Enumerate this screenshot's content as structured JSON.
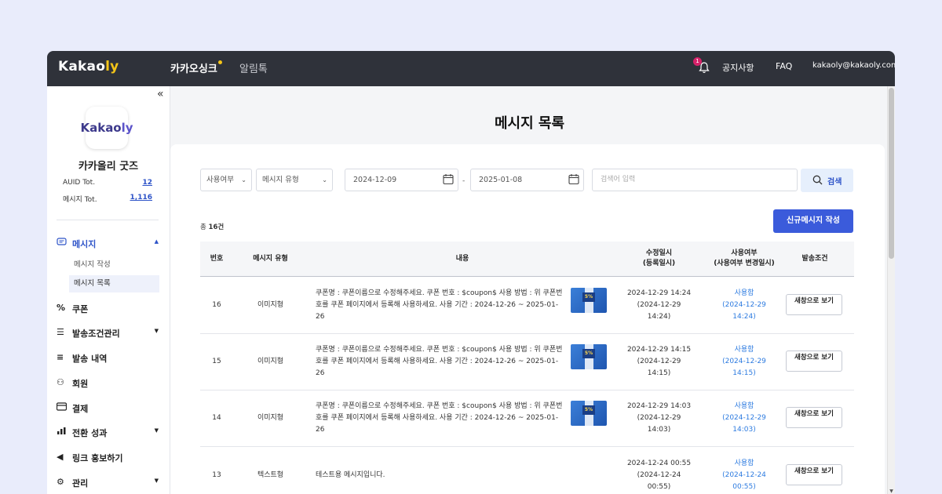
{
  "header": {
    "logo_main": "Kakao",
    "logo_accent": "ly",
    "nav": [
      {
        "label": "카카오싱크"
      },
      {
        "label": "알림톡"
      }
    ],
    "notification_count": "1",
    "links": {
      "notice": "공지사항",
      "faq": "FAQ",
      "account": "kakaoly@kakaoly.com"
    }
  },
  "sidebar": {
    "collapse_label": "«",
    "avatar_main": "Kakao",
    "avatar_accent": "ly",
    "company": "카카올리 굿즈",
    "stats": [
      {
        "label": "AUID Tot.",
        "value": "12"
      },
      {
        "label": "메시지 Tot.",
        "value": "1,116"
      }
    ],
    "menu": [
      {
        "label": "메시지",
        "icon": "chat-icon",
        "glyph": "▭",
        "caret": "▲"
      },
      {
        "label": "쿠폰",
        "icon": "percent-icon",
        "glyph": "%",
        "caret": ""
      },
      {
        "label": "발송조건관리",
        "icon": "filter-search-icon",
        "glyph": "☰",
        "caret": "▼"
      },
      {
        "label": "발송 내역",
        "icon": "send-list-icon",
        "glyph": "≡",
        "caret": ""
      },
      {
        "label": "회원",
        "icon": "members-icon",
        "glyph": "⚇",
        "caret": ""
      },
      {
        "label": "결제",
        "icon": "card-icon",
        "glyph": "▭",
        "caret": ""
      },
      {
        "label": "전환 성과",
        "icon": "bar-chart-icon",
        "glyph": "▟",
        "caret": "▼"
      },
      {
        "label": "링크 홍보하기",
        "icon": "megaphone-icon",
        "glyph": "◀",
        "caret": ""
      },
      {
        "label": "관리",
        "icon": "gear-icon",
        "glyph": "⚙",
        "caret": "▼"
      }
    ],
    "submenu": [
      {
        "label": "메시지 작성"
      },
      {
        "label": "메시지 목록"
      }
    ]
  },
  "main": {
    "title": "메시지 목록",
    "filters": {
      "usage": "사용여부",
      "type": "메시지 유형",
      "date_from": "2024-12-09",
      "date_to": "2025-01-08",
      "date_separator": "-",
      "search_placeholder": "검색어 입력",
      "search_label": "검색"
    },
    "total_prefix": "총 ",
    "total_count": "16건",
    "new_button": "신규메시지 작성",
    "columns": [
      {
        "label": "번호"
      },
      {
        "label": "메시지 유형"
      },
      {
        "label": "내용"
      },
      {
        "label": "수정일시\n(등록일시)"
      },
      {
        "label": "사용여부\n(사용여부 변경일시)"
      },
      {
        "label": "발송조건"
      }
    ],
    "rows": [
      {
        "no": "16",
        "type": "이미지형",
        "content": "쿠폰명 : 쿠폰이름으로 수정해주세요. 쿠폰 번호 : $coupon$ 사용 방법 : 위 쿠폰번호를 쿠폰 페이지에서 등록해 사용하세요. 사용 기간 : 2024-12-26 ~ 2025-01-26",
        "has_image": true,
        "modified": "2024-12-29 14:24",
        "registered": "(2024-12-29 14:24)",
        "usage": "사용함",
        "usage_date": "(2024-12-29 14:24)",
        "view": "새창으로 보기"
      },
      {
        "no": "15",
        "type": "이미지형",
        "content": "쿠폰명 : 쿠폰이름으로 수정해주세요. 쿠폰 번호 : $coupon$ 사용 방법 : 위 쿠폰번호를 쿠폰 페이지에서 등록해 사용하세요. 사용 기간 : 2024-12-26 ~ 2025-01-26",
        "has_image": true,
        "modified": "2024-12-29 14:15",
        "registered": "(2024-12-29 14:15)",
        "usage": "사용함",
        "usage_date": "(2024-12-29 14:15)",
        "view": "새창으로 보기"
      },
      {
        "no": "14",
        "type": "이미지형",
        "content": "쿠폰명 : 쿠폰이름으로 수정해주세요. 쿠폰 번호 : $coupon$ 사용 방법 : 위 쿠폰번호를 쿠폰 페이지에서 등록해 사용하세요. 사용 기간 : 2024-12-26 ~ 2025-01-26",
        "has_image": true,
        "modified": "2024-12-29 14:03",
        "registered": "(2024-12-29 14:03)",
        "usage": "사용함",
        "usage_date": "(2024-12-29 14:03)",
        "view": "새창으로 보기"
      },
      {
        "no": "13",
        "type": "텍스트형",
        "content": "테스트용 메시지입니다.",
        "has_image": false,
        "modified": "2024-12-24 00:55",
        "registered": "(2024-12-24 00:55)",
        "usage": "사용함",
        "usage_date": "(2024-12-24 00:55)",
        "view": "새창으로 보기"
      }
    ],
    "thumb_text": "5%"
  },
  "colors": {
    "accent": "#3b5bdb",
    "link": "#2d7be0",
    "topbar": "#2f323a",
    "logo_accent": "#f5c518",
    "badge": "#d6226a"
  }
}
